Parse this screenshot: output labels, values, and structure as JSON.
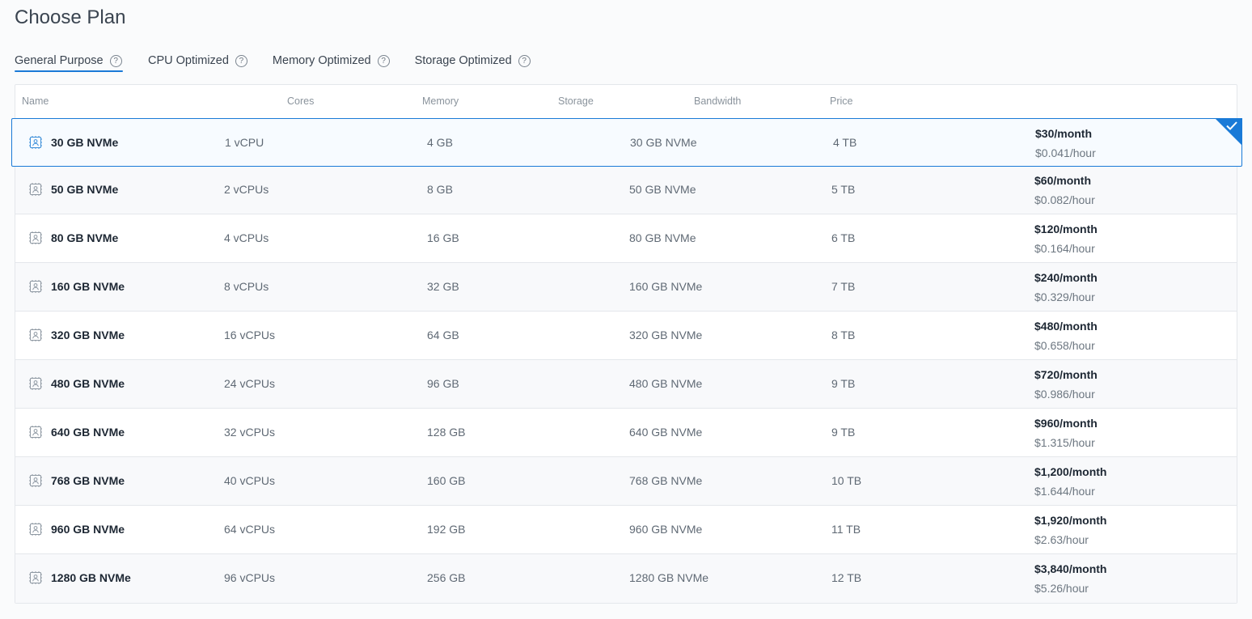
{
  "page": {
    "title": "Choose Plan"
  },
  "tabs": [
    {
      "label": "General Purpose",
      "help": "?",
      "active": true
    },
    {
      "label": "CPU Optimized",
      "help": "?"
    },
    {
      "label": "Memory Optimized",
      "help": "?"
    },
    {
      "label": "Storage Optimized",
      "help": "?"
    }
  ],
  "table": {
    "columns": [
      "Name",
      "Cores",
      "Memory",
      "Storage",
      "Bandwidth",
      "Price"
    ],
    "rows": [
      {
        "name": "30 GB NVMe",
        "cores": "1 vCPU",
        "memory": "4 GB",
        "storage": "30 GB NVMe",
        "bandwidth": "4 TB",
        "price_month": "$30/month",
        "price_hour": "$0.041/hour",
        "selected": true
      },
      {
        "name": "50 GB NVMe",
        "cores": "2 vCPUs",
        "memory": "8 GB",
        "storage": "50 GB NVMe",
        "bandwidth": "5 TB",
        "price_month": "$60/month",
        "price_hour": "$0.082/hour"
      },
      {
        "name": "80 GB NVMe",
        "cores": "4 vCPUs",
        "memory": "16 GB",
        "storage": "80 GB NVMe",
        "bandwidth": "6 TB",
        "price_month": "$120/month",
        "price_hour": "$0.164/hour"
      },
      {
        "name": "160 GB NVMe",
        "cores": "8 vCPUs",
        "memory": "32 GB",
        "storage": "160 GB NVMe",
        "bandwidth": "7 TB",
        "price_month": "$240/month",
        "price_hour": "$0.329/hour"
      },
      {
        "name": "320 GB NVMe",
        "cores": "16 vCPUs",
        "memory": "64 GB",
        "storage": "320 GB NVMe",
        "bandwidth": "8 TB",
        "price_month": "$480/month",
        "price_hour": "$0.658/hour"
      },
      {
        "name": "480 GB NVMe",
        "cores": "24 vCPUs",
        "memory": "96 GB",
        "storage": "480 GB NVMe",
        "bandwidth": "9 TB",
        "price_month": "$720/month",
        "price_hour": "$0.986/hour"
      },
      {
        "name": "640 GB NVMe",
        "cores": "32 vCPUs",
        "memory": "128 GB",
        "storage": "640 GB NVMe",
        "bandwidth": "9 TB",
        "price_month": "$960/month",
        "price_hour": "$1.315/hour"
      },
      {
        "name": "768 GB NVMe",
        "cores": "40 vCPUs",
        "memory": "160 GB",
        "storage": "768 GB NVMe",
        "bandwidth": "10 TB",
        "price_month": "$1,200/month",
        "price_hour": "$1.644/hour"
      },
      {
        "name": "960 GB NVMe",
        "cores": "64 vCPUs",
        "memory": "192 GB",
        "storage": "960 GB NVMe",
        "bandwidth": "11 TB",
        "price_month": "$1,920/month",
        "price_hour": "$2.63/hour"
      },
      {
        "name": "1280 GB NVMe",
        "cores": "96 vCPUs",
        "memory": "256 GB",
        "storage": "1280 GB NVMe",
        "bandwidth": "12 TB",
        "price_month": "$3,840/month",
        "price_hour": "$5.26/hour"
      }
    ]
  },
  "icons": {
    "plan": "plan-user-icon",
    "help": "help-circle-icon",
    "check": "checkmark-icon"
  },
  "colors": {
    "accent": "#1a7ad7",
    "border": "#e4e7eb",
    "text": "#1d2733",
    "muted": "#5f6974"
  }
}
